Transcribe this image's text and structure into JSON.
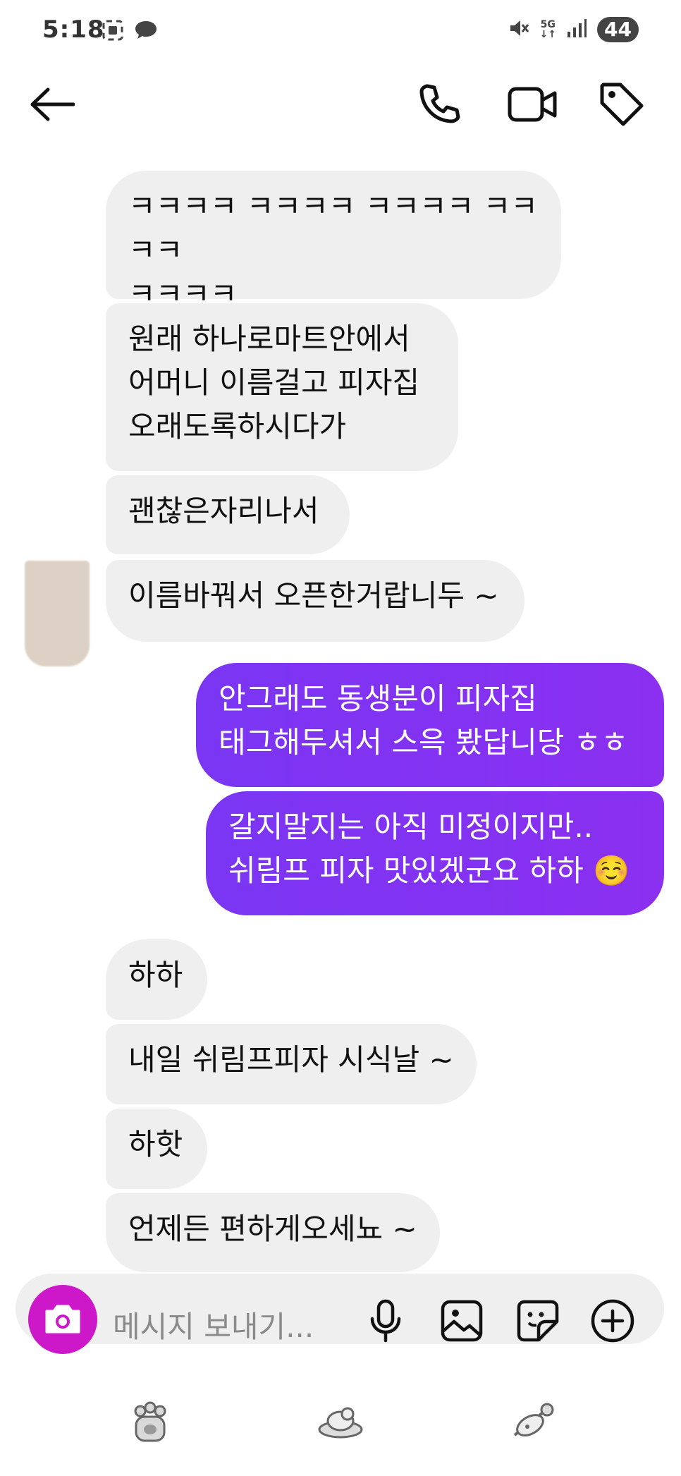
{
  "status_bar": {
    "time": "5:18",
    "battery": "44",
    "network": "5G",
    "icons": [
      "screenshot-icon",
      "chat-icon",
      "mute-icon",
      "signal-icon",
      "battery-icon"
    ]
  },
  "header": {
    "icons": [
      "back-arrow-icon",
      "phone-icon",
      "video-icon",
      "tag-icon"
    ]
  },
  "messages": [
    {
      "dir": "in",
      "text": "ㅋㅋㅋㅋ ㅋㅋㅋㅋ ㅋㅋㅋㅋ ㅋㅋㅋㅋ\nㅋㅋㅋㅋ"
    },
    {
      "dir": "in",
      "text": "원래 하나로마트안에서\n어머니 이름걸고 피자집\n오래도록하시다가"
    },
    {
      "dir": "in",
      "text": "괜찮은자리나서"
    },
    {
      "dir": "in",
      "text": "이름바꿔서 오픈한거랍니두 ~"
    },
    {
      "dir": "out",
      "text": "안그래도 동생분이 피자집\n태그해두셔서 스윽 봤답니당 ㅎㅎ"
    },
    {
      "dir": "out",
      "text": "갈지말지는 아직 미정이지만..\n쉬림프 피자 맛있겠군요 하하 ☺️"
    },
    {
      "dir": "in",
      "text": "하하"
    },
    {
      "dir": "in",
      "text": "내일 쉬림프피자 시식날 ~"
    },
    {
      "dir": "in",
      "text": "하핫"
    },
    {
      "dir": "in",
      "text": "언제든 편하게오세뇨 ~"
    }
  ],
  "composer": {
    "placeholder": "메시지 보내기...",
    "icons": [
      "camera-icon",
      "microphone-icon",
      "gallery-icon",
      "sticker-icon",
      "plus-icon"
    ]
  },
  "bottom_nav": {
    "icons": [
      "paw-icon",
      "sleeping-dog-icon",
      "dog-toy-icon"
    ]
  },
  "colors": {
    "outgoing_bubble": "#8133f2",
    "incoming_bubble": "#efefef",
    "camera_button": "#cc18c8"
  }
}
